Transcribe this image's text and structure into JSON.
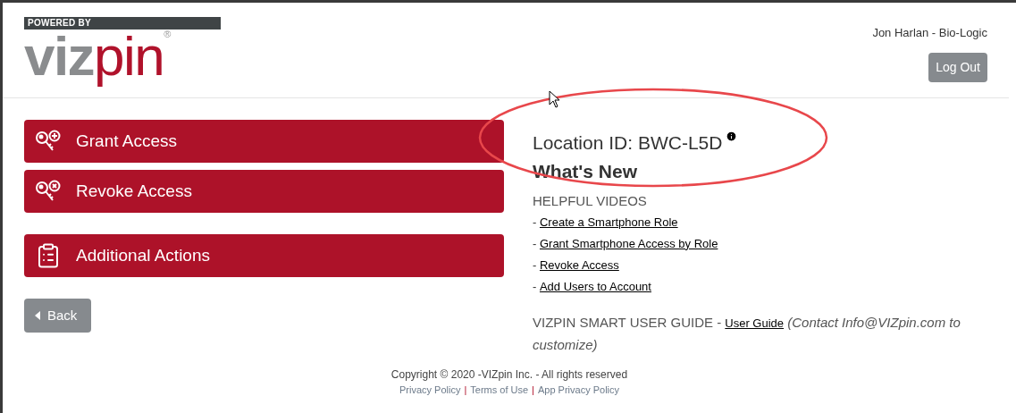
{
  "logo": {
    "tagline": "POWERED BY",
    "name_part_1": "viz",
    "name_part_2": "pin",
    "mark": "®"
  },
  "user": {
    "name": "Jon Harlan - Bio-Logic",
    "logout": "Log Out"
  },
  "actions": [
    {
      "kind": "grant",
      "label": "Grant Access"
    },
    {
      "kind": "revoke",
      "label": "Revoke Access"
    },
    {
      "kind": "list",
      "label": "Additional Actions"
    }
  ],
  "back": "Back",
  "location": "Location ID: BWC-L5D",
  "whats_new": "What's New",
  "videos_heading": "HELPFUL VIDEOS",
  "videos": [
    {
      "prefix": "- ",
      "link": "Create a Smartphone Role"
    },
    {
      "prefix": "- ",
      "link": "Grant Smartphone Access by Role"
    },
    {
      "prefix": "- ",
      "link": "Revoke Access"
    },
    {
      "prefix": "- ",
      "link": "Add Users to Account"
    }
  ],
  "guide": {
    "label": "VIZPIN SMART USER GUIDE - ",
    "link": "User Guide",
    "note": "(Contact Info@VIZpin.com to customize)"
  },
  "footer": {
    "copyright": "Copyright © 2020 -VIZpin Inc. - All rights reserved",
    "links": [
      {
        "kind": "link",
        "text": "Privacy Policy"
      },
      {
        "kind": "separator",
        "text": "|"
      },
      {
        "kind": "link",
        "text": "Terms of Use"
      },
      {
        "kind": "separator",
        "text": "|"
      },
      {
        "kind": "link",
        "text": "App Privacy Policy"
      }
    ]
  }
}
